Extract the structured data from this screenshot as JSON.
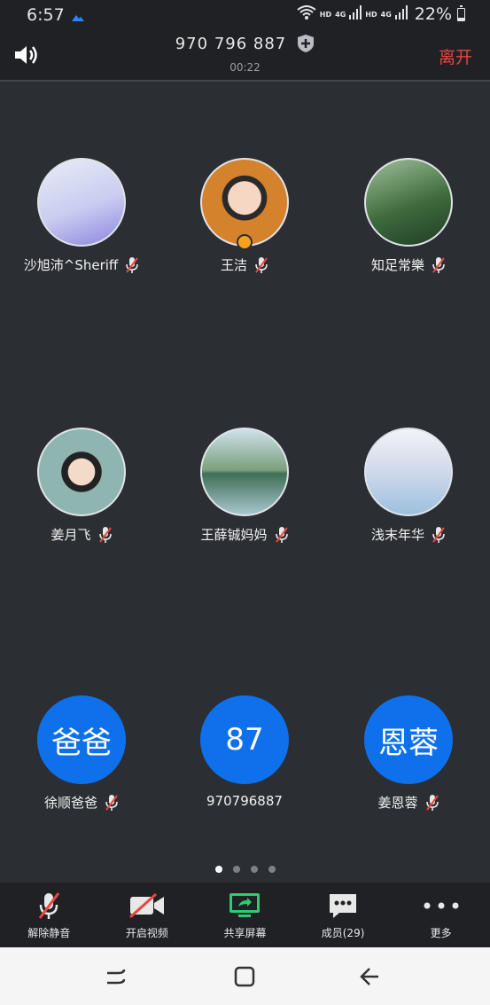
{
  "status_bar": {
    "time": "6:57",
    "hd1": "HD",
    "net1": "4G",
    "hd2": "HD",
    "net2": "4G",
    "battery": "22%",
    "battery_level": 0.22
  },
  "header": {
    "meeting_id": "970 796 887",
    "timer": "00:22",
    "leave_label": "离开"
  },
  "participants": [
    {
      "name": "沙旭沛^Sheriff",
      "avatar": "photo",
      "muted": true
    },
    {
      "name": "王洁",
      "avatar": "photo",
      "host": true,
      "muted": true
    },
    {
      "name": "知足常樂",
      "avatar": "photo",
      "muted": true
    },
    {
      "name": "姜月飞",
      "avatar": "photo",
      "muted": true
    },
    {
      "name": "王薛铖妈妈",
      "avatar": "photo",
      "muted": true
    },
    {
      "name": "浅末年华",
      "avatar": "photo",
      "muted": true
    },
    {
      "name": "徐顺爸爸",
      "initials": "爸爸",
      "muted": true
    },
    {
      "name": "970796887",
      "initials": "87",
      "muted": false
    },
    {
      "name": "姜恩蓉",
      "initials": "恩蓉",
      "muted": true
    }
  ],
  "pagination": {
    "pages": 4,
    "current": 1
  },
  "toolbar": {
    "unmute": "解除静音",
    "video": "开启视频",
    "share": "共享屏幕",
    "members": "成员(29)",
    "more": "更多"
  },
  "colors": {
    "accent_blue": "#0e71eb",
    "leave_red": "#e8463e",
    "share_green": "#2ecc71",
    "mute_red": "#e8463e"
  }
}
